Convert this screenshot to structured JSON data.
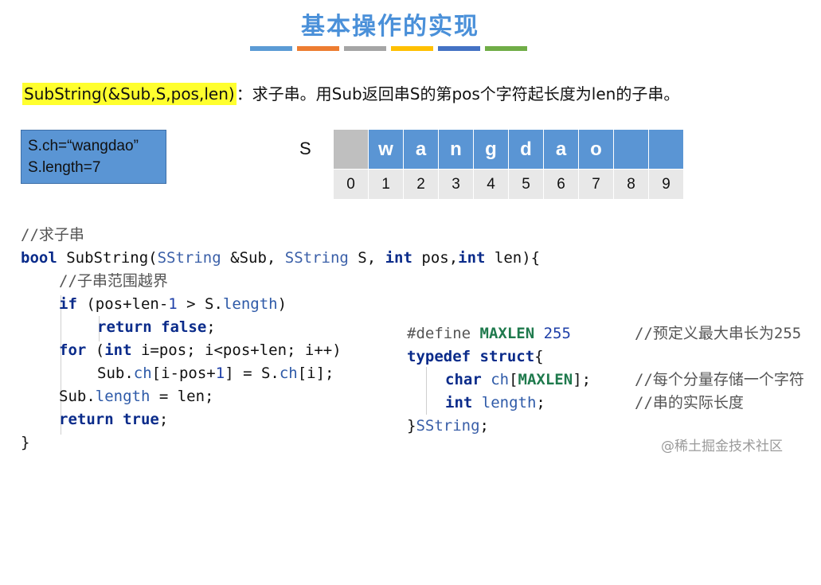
{
  "slide": {
    "title": "基本操作的实现",
    "color_bars": [
      "#5b9bd5",
      "#ed7d31",
      "#a5a5a5",
      "#ffc000",
      "#4472c4",
      "#70ad47"
    ],
    "description_highlight": "SubString(&Sub,S,pos,len)",
    "description_rest": "：求子串。用Sub返回串S的第pos个字符起长度为len的子串。",
    "info_box": {
      "line1": "S.ch=“wangdao”",
      "line2": "S.length=7"
    },
    "string_label": "S",
    "chars": [
      "",
      "w",
      "a",
      "n",
      "g",
      "d",
      "a",
      "o",
      "",
      ""
    ],
    "indices": [
      "0",
      "1",
      "2",
      "3",
      "4",
      "5",
      "6",
      "7",
      "8",
      "9"
    ],
    "watermark": "@稀土掘金技术社区"
  },
  "code_left": {
    "comment_head": "//求子串",
    "sig_bool": "bool",
    "sig_name": " SubString(",
    "sig_type1": "SString",
    "sig_p1": " &Sub, ",
    "sig_type2": "SString",
    "sig_p2": " S, ",
    "sig_int1": "int",
    "sig_p3": " pos,",
    "sig_int2": "int",
    "sig_p4": " len){",
    "comment_range": "//子串范围越界",
    "if_kw": "if",
    "if_a": " (pos+len-",
    "if_num": "1",
    "if_b": " > S.",
    "if_field": "length",
    "if_c": ")",
    "ret_kw": "return",
    "ret_val": " false",
    "ret_end": ";",
    "for_kw": "for",
    "for_a": " (",
    "for_int": "int",
    "for_b": " i=pos; i<pos+len; i++)",
    "assign_a": "Sub.",
    "assign_f1": "ch",
    "assign_b": "[i-pos+",
    "assign_num": "1",
    "assign_c": "] = S.",
    "assign_f2": "ch",
    "assign_d": "[i];",
    "len_a": "Sub.",
    "len_f": "length",
    "len_b": " = len;",
    "ret2_kw": "return",
    "ret2_val": " true",
    "ret2_end": ";",
    "close": "}"
  },
  "code_right": {
    "define_kw": "#define",
    "define_name": " MAXLEN",
    "define_val": " 255",
    "define_comment": "//预定义最大串长为255",
    "typedef_kw": "typedef",
    "struct_kw": " struct",
    "brace_open": "{",
    "char_kw": "char",
    "char_field": " ch",
    "char_b": "[",
    "char_macro": "MAXLEN",
    "char_c": "];",
    "char_comment": "//每个分量存储一个字符",
    "int_kw": "int",
    "int_field": " length",
    "int_end": ";",
    "int_comment": "//串的实际长度",
    "close": "}",
    "close_type": "SString",
    "close_end": ";"
  }
}
